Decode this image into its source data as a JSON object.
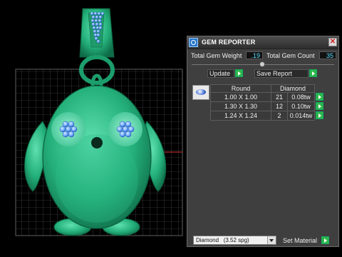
{
  "panel": {
    "title": "GEM REPORTER",
    "total_weight_label": "Total Gem Weight",
    "total_weight_value": ".19",
    "total_count_label": "Total Gem Count",
    "total_count_value": "35",
    "update_label": "Update",
    "save_report_label": "Save Report",
    "close_icon": "close-icon",
    "app_icon": "gem-reporter-icon"
  },
  "table": {
    "headers": [
      "Round",
      "Diamond"
    ],
    "rows": [
      {
        "size": "1.00 X 1.00",
        "count": "21",
        "weight": "0.08tw"
      },
      {
        "size": "1.30 X 1.30",
        "count": "12",
        "weight": "0.10tw"
      },
      {
        "size": "1.24 X 1.24",
        "count": "2",
        "weight": "0.014tw"
      }
    ]
  },
  "material": {
    "selected": "Diamond",
    "spg": "(3.52 spg)",
    "set_label": "Set Material"
  },
  "colors": {
    "model_green": "#2fbf8a",
    "gem_blue": "#6aa8ff",
    "value_cyan": "#58e0ff",
    "go_green": "#2fb84a"
  }
}
